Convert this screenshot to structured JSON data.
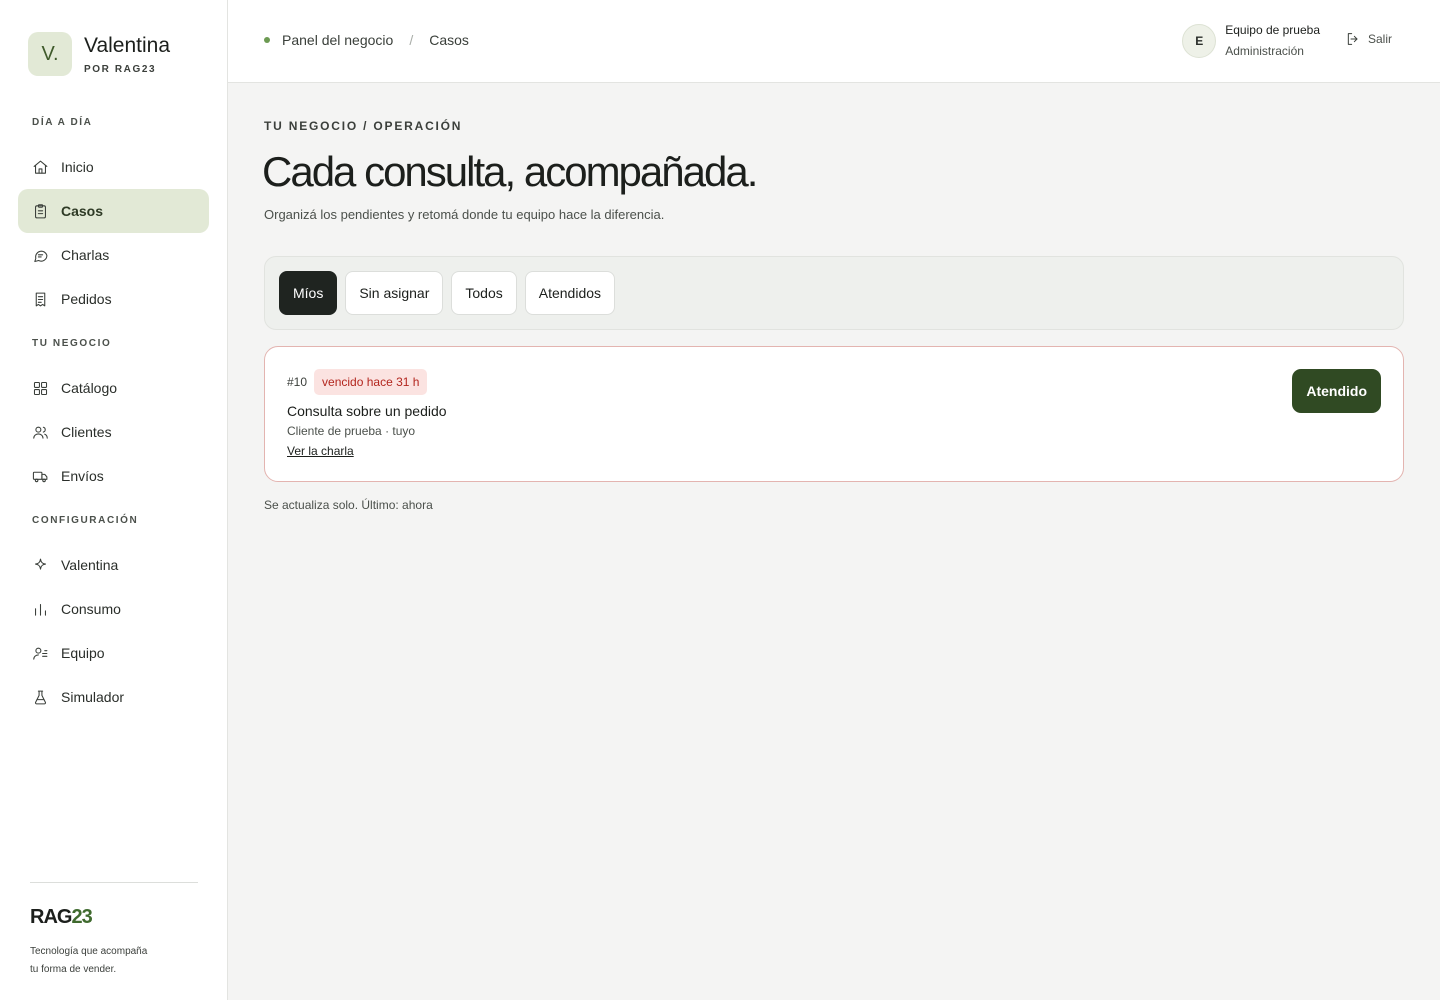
{
  "brand": {
    "mark": "V.",
    "name": "Valentina",
    "sub": "POR RAG23"
  },
  "sidebar": {
    "sections": [
      {
        "heading": "DÍA A DÍA",
        "items": [
          {
            "label": "Inicio",
            "icon": "home-icon"
          },
          {
            "label": "Casos",
            "icon": "clipboard-icon",
            "active": true
          },
          {
            "label": "Charlas",
            "icon": "chat-bubble-icon"
          },
          {
            "label": "Pedidos",
            "icon": "receipt-icon"
          }
        ]
      },
      {
        "heading": "TU NEGOCIO",
        "items": [
          {
            "label": "Catálogo",
            "icon": "grid-icon"
          },
          {
            "label": "Clientes",
            "icon": "users-icon"
          },
          {
            "label": "Envíos",
            "icon": "truck-icon"
          }
        ]
      },
      {
        "heading": "CONFIGURACIÓN",
        "items": [
          {
            "label": "Valentina",
            "icon": "sparkle-icon"
          },
          {
            "label": "Consumo",
            "icon": "bar-chart-icon"
          },
          {
            "label": "Equipo",
            "icon": "user-list-icon"
          },
          {
            "label": "Simulador",
            "icon": "flask-icon"
          }
        ]
      }
    ],
    "footer": {
      "logo_main": "RAG",
      "logo_accent": "23",
      "tagline_1": "Tecnología que acompaña",
      "tagline_2": "tu forma de vender."
    }
  },
  "header": {
    "breadcrumb": [
      "Panel del negocio",
      "Casos"
    ],
    "breadcrumb_sep": "/",
    "user": {
      "initial": "E",
      "name": "Equipo de prueba",
      "role": "Administración"
    },
    "logout_label": "Salir"
  },
  "main": {
    "eyebrow": "TU NEGOCIO / OPERACIÓN",
    "title": "Cada consulta, acompañada.",
    "subtitle": "Organizá los pendientes y retomá donde tu equipo hace la diferencia.",
    "tabs": [
      {
        "label": "Míos",
        "active": true
      },
      {
        "label": "Sin asignar"
      },
      {
        "label": "Todos"
      },
      {
        "label": "Atendidos"
      }
    ],
    "cases": [
      {
        "number": "#10",
        "badge": "vencido hace 31 h",
        "title": "Consulta sobre un pedido",
        "meta": "Cliente de prueba · tuyo",
        "link": "Ver la charla",
        "action": "Atendido"
      }
    ],
    "status": "Se actualiza solo. Último: ahora"
  },
  "colors": {
    "accent": "#304a23",
    "active_bg": "#e2e9d6",
    "danger": "#b3261e",
    "danger_bg": "#fbe3e1"
  }
}
